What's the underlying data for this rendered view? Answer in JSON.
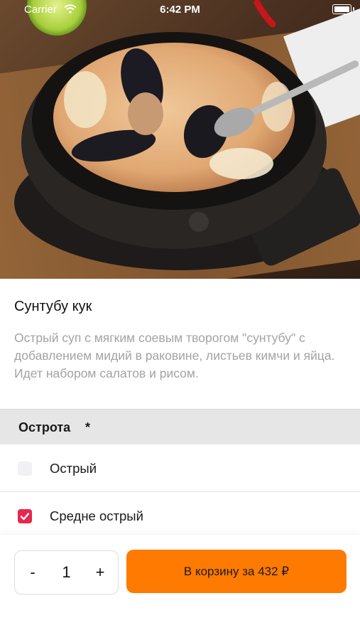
{
  "status_bar": {
    "carrier": "Carrier",
    "time": "6:42 PM"
  },
  "product": {
    "title": "Сунтубу кук",
    "description": "Острый суп с мягким соевым творогом \"сунтубу\" с добавлением мидий в раковине, листьев кимчи и яйца. Идет набором салатов и рисом."
  },
  "options_group": {
    "title": "Острота",
    "required_mark": "*",
    "items": [
      {
        "label": "Острый",
        "checked": false
      },
      {
        "label": "Средне острый",
        "checked": true
      }
    ]
  },
  "cart_bar": {
    "minus_label": "-",
    "quantity": "1",
    "plus_label": "+",
    "add_button_label": "В корзину за 432 ₽",
    "accent": "#ff7a00",
    "checkbox_color": "#e8264f"
  }
}
